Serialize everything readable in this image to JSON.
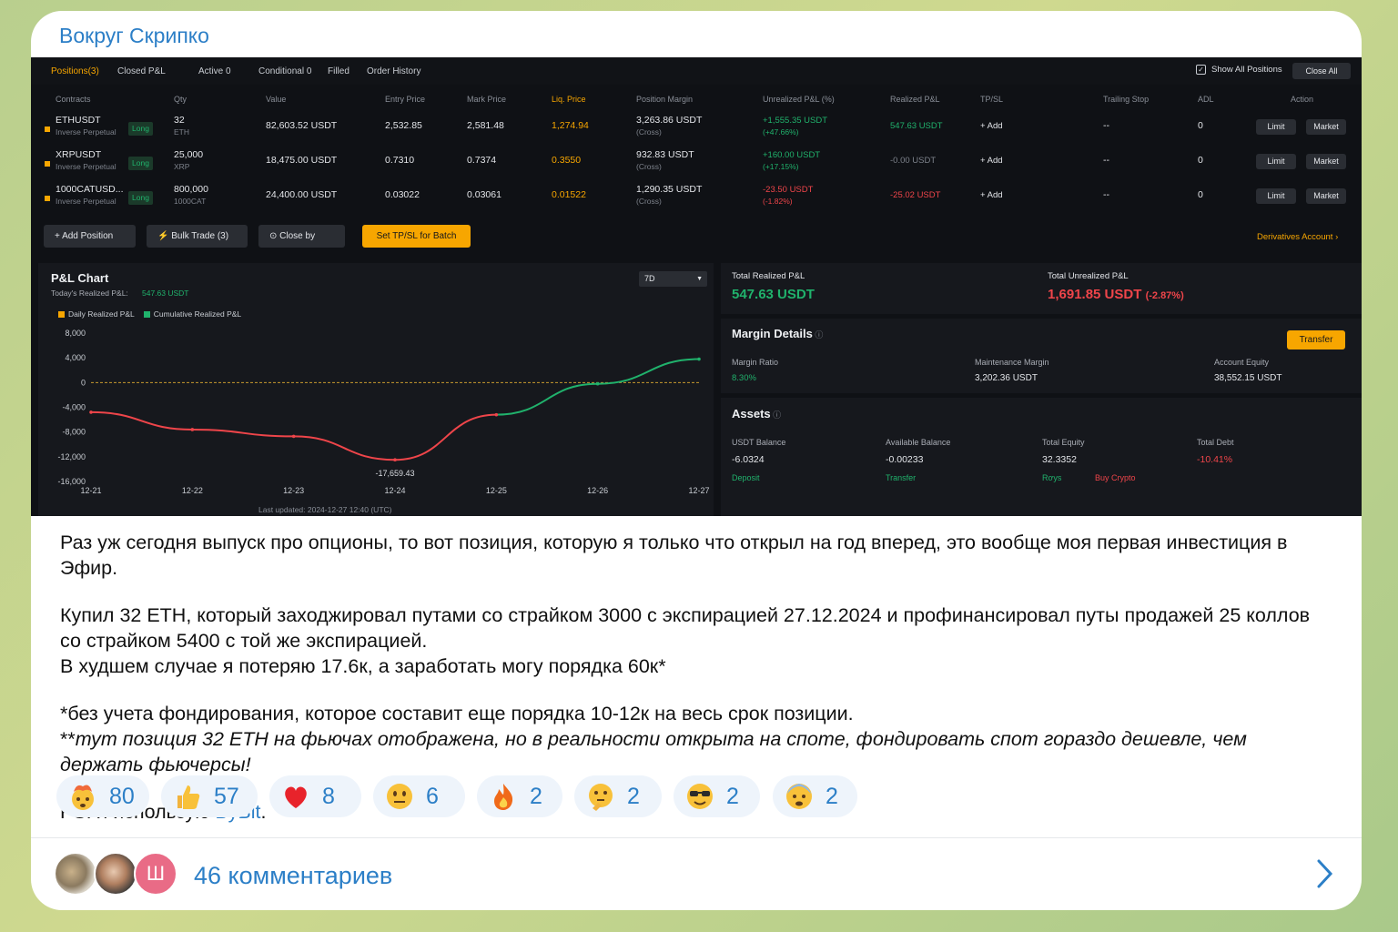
{
  "channel": {
    "name": "Вокруг Скрипко"
  },
  "screenshot": {
    "tabs": [
      {
        "label": "Positions(3)",
        "active": true
      },
      {
        "label": "Closed P&L",
        "active": false
      },
      {
        "label": "Active 0",
        "active": false
      },
      {
        "label": "Conditional 0",
        "active": false
      },
      {
        "label": "Filled",
        "active": false
      },
      {
        "label": "Order History",
        "active": false
      }
    ],
    "show_all_positions": "Show All Positions",
    "close_all": "Close All",
    "columns": [
      "Contracts",
      "Qty",
      "Value",
      "Entry Price",
      "Mark Price",
      "Liq. Price",
      "Position Margin",
      "Unrealized P&L (%)",
      "Realized P&L",
      "TP/SL",
      "Trailing Stop",
      "ADL",
      "Action"
    ],
    "positions": [
      {
        "contract": "ETHUSDT",
        "type": "Inverse Perpetual",
        "side": "Long",
        "qty": "32",
        "qty_unit": "ETH",
        "value": "82,603.52 USDT",
        "entry": "2,532.85",
        "mark": "2,581.48",
        "liq": "1,274.94",
        "margin": "3,263.86 USDT",
        "margin_mode": "(Cross)",
        "upnl": "+1,555.35 USDT",
        "upnl_pct": "(+47.66%)",
        "rpnl": "547.63 USDT",
        "tpsl": "+ Add",
        "trailing": "--",
        "adl": "0",
        "limit": "Limit",
        "market": "Market"
      },
      {
        "contract": "XRPUSDT",
        "type": "Inverse Perpetual",
        "side": "Long",
        "qty": "25,000",
        "qty_unit": "XRP",
        "value": "18,475.00 USDT",
        "entry": "0.7310",
        "mark": "0.7374",
        "liq": "0.3550",
        "margin": "932.83 USDT",
        "margin_mode": "(Cross)",
        "upnl": "+160.00 USDT",
        "upnl_pct": "(+17.15%)",
        "rpnl": "-0.00 USDT",
        "tpsl": "+ Add",
        "trailing": "--",
        "adl": "0",
        "limit": "Limit",
        "market": "Market"
      },
      {
        "contract": "1000CATUSD...",
        "type": "Inverse Perpetual",
        "side": "Long",
        "qty": "800,000",
        "qty_unit": "1000CAT",
        "value": "24,400.00 USDT",
        "entry": "0.03022",
        "mark": "0.03061",
        "liq": "0.01522",
        "margin": "1,290.35 USDT",
        "margin_mode": "(Cross)",
        "upnl": "-23.50 USDT",
        "upnl_pct": "(-1.82%)",
        "rpnl": "-25.02 USDT",
        "tpsl": "+ Add",
        "trailing": "--",
        "adl": "0",
        "limit": "Limit",
        "market": "Market"
      }
    ],
    "actions": {
      "add_position": "Add Position",
      "bulk_trade": "Bulk Trade (3)",
      "close_by": "Close by",
      "set_tpsl": "Set TP/SL for Batch",
      "derivatives_account": "Derivatives Account"
    },
    "pnl_chart": {
      "title": "P&L Chart",
      "today_label": "Today's Realized P&L:",
      "today_value": "547.63 USDT",
      "period": "7D",
      "legend": [
        "Daily Realized P&L",
        "Cumulative Realized P&L"
      ],
      "last_updated": "Last updated:  2024-12-27  12:40 (UTC)",
      "annotation": "-17,659.43"
    },
    "summary": {
      "total_realized_label": "Total Realized P&L",
      "total_realized_value": "547.63  USDT",
      "total_unrealized_label": "Total Unrealized P&L",
      "total_unrealized_value": "1,691.85  USDT",
      "total_unrealized_pct": "(-2.87%)"
    },
    "margin_details": {
      "title": "Margin Details",
      "transfer": "Transfer",
      "margin_ratio_label": "Margin Ratio",
      "margin_ratio": "8.30%",
      "maintenance_label": "Maintenance Margin",
      "maintenance": "3,202.36 USDT",
      "equity_label": "Account Equity",
      "equity": "38,552.15 USDT"
    },
    "assets": {
      "title": "Assets",
      "usdt_balance_label": "USDT Balance",
      "usdt_balance": "-6.0324",
      "available_label": "Available Balance",
      "available": "-0.00233",
      "total_equity_label": "Total Equity",
      "total_equity": "32.3352",
      "total_debt_label": "Total Debt",
      "total_debt": "-10.41%",
      "deposit": "Deposit",
      "transfer": "Transfer",
      "ruys": "Rơys",
      "buy_crypto": "Buy Crypto"
    },
    "colors": {
      "accent": "#f7a600",
      "profit": "#20b26c",
      "loss": "#ef454a",
      "bg": "#0f1115"
    }
  },
  "chart_data": {
    "type": "line",
    "title": "P&L Chart",
    "categories": [
      "12-21",
      "12-22",
      "12-23",
      "12-24",
      "12-25",
      "12-26",
      "12-27"
    ],
    "y_ticks": [
      "8,000",
      "4,000",
      "0",
      "-4,000",
      "-8,000",
      "-12,000",
      "-16,000"
    ],
    "ylim": [
      -16000,
      8000
    ],
    "series": [
      {
        "name": "Cumulative Realized P&L",
        "values": [
          -4800,
          -7600,
          -8700,
          -12500,
          -5200,
          -200,
          3800
        ]
      }
    ],
    "annotation_value": -17659.43
  },
  "post": {
    "p1": "Раз уж сегодня выпуск про опционы, то вот позиция, которую я только что открыл на год вперед, это вообще моя первая инвестиция в Эфир.",
    "p2a": "Купил 32 ETH, который заходжировал путами со страйком  3000 с экспирацией 27.12.2024 и профинансировал путы продажей 25 коллов со страйком 5400 с той же экспирацией.",
    "p2b": "В худшем случае я потеряю 17.6к, а заработать могу порядка 60к*",
    "p3a": "*без учета фондирования, которое составит еще порядка 10-12к на весь срок позиции.",
    "p3b_prefix": "**",
    "p3b": "тут позиция 32 ETH на фьючах отображена, но в реальности открыта на споте, фондировать спот гораздо дешевле, чем держать фьючерсы!",
    "ps_prefix": "PS: я использую ",
    "ps_link": "ByBit",
    "ps_suffix": "."
  },
  "reactions": [
    {
      "icon": "exploding-head-icon",
      "count": "80"
    },
    {
      "icon": "thumbs-up-icon",
      "count": "57"
    },
    {
      "icon": "red-heart-icon",
      "count": "8"
    },
    {
      "icon": "neutral-face-icon",
      "count": "6"
    },
    {
      "icon": "fire-icon",
      "count": "2"
    },
    {
      "icon": "thinking-face-icon",
      "count": "2"
    },
    {
      "icon": "nerd-face-icon",
      "count": "2"
    },
    {
      "icon": "fearful-face-icon",
      "count": "2"
    }
  ],
  "comments": {
    "label": "46 комментариев",
    "avatar_letter": "Ш"
  }
}
